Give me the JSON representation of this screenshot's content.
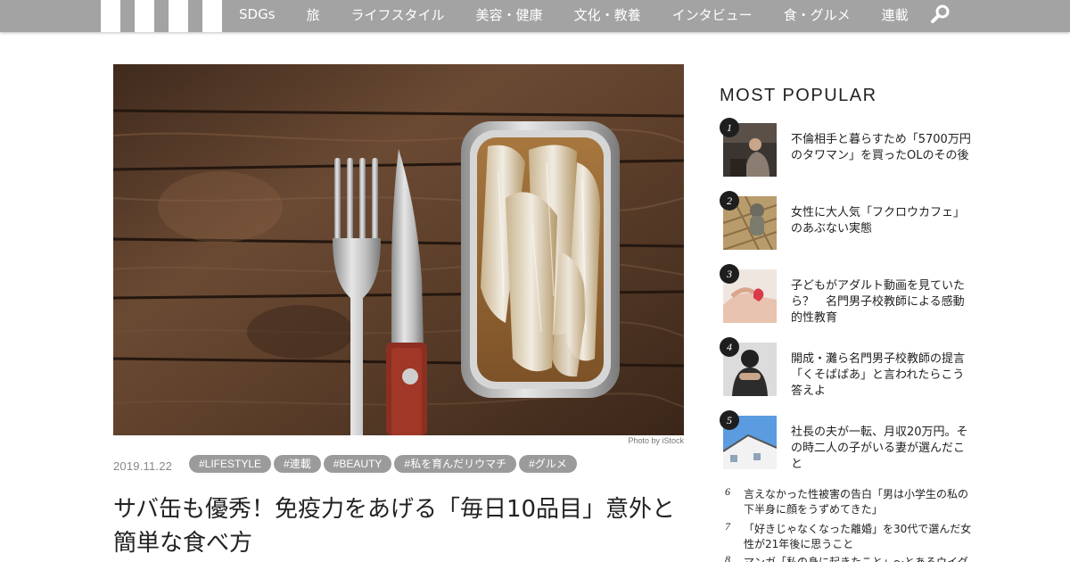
{
  "nav": {
    "items": [
      "SDGs",
      "旅",
      "ライフスタイル",
      "美容・健康",
      "文化・教養",
      "インタビュー",
      "食・グルメ",
      "連載"
    ]
  },
  "icons": {
    "search": "search-icon",
    "logo": "site-logo-stripes"
  },
  "colors": {
    "nav_bg": "#a3a3a3",
    "tag_bg": "#9b9b9b",
    "rank_badge": "#1e1e1e"
  },
  "article": {
    "photo_credit": "Photo by iStock",
    "date": "2019.11.22",
    "tags": [
      "#LIFESTYLE",
      "#連載",
      "#BEAUTY",
      "#私を育んだリウマチ",
      "#グルメ"
    ],
    "title": "サバ缶も優秀！免疫力をあげる「毎日10品目」意外と簡単な食べ方"
  },
  "sidebar": {
    "heading": "MOST POPULAR",
    "ranked": [
      {
        "rank": "1",
        "text": "不倫相手と暮らすため「5700万円のタワマン」を買ったOLのその後"
      },
      {
        "rank": "2",
        "text": "女性に大人気「フクロウカフェ」のあぶない実態"
      },
      {
        "rank": "3",
        "text": "子どもがアダルト動画を見ていたら？　名門男子校教師による感動的性教育"
      },
      {
        "rank": "4",
        "text": "開成・灘ら名門男子校教師の提言「くそばばあ」と言われたらこう答えよ"
      },
      {
        "rank": "5",
        "text": "社長の夫が一転、月収20万円。その時二人の子がいる妻が選んだこと"
      }
    ],
    "more": [
      {
        "rank": "6",
        "text": "言えなかった性被害の告白「男は小学生の私の下半身に顔をうずめてきた」"
      },
      {
        "rank": "7",
        "text": "「好きじゃなくなった離婚」を30代で選んだ女性が21年後に思うこと"
      },
      {
        "rank": "8",
        "text": "マンガ「私の身に起きたこと」〜とあるウイグル"
      }
    ]
  }
}
